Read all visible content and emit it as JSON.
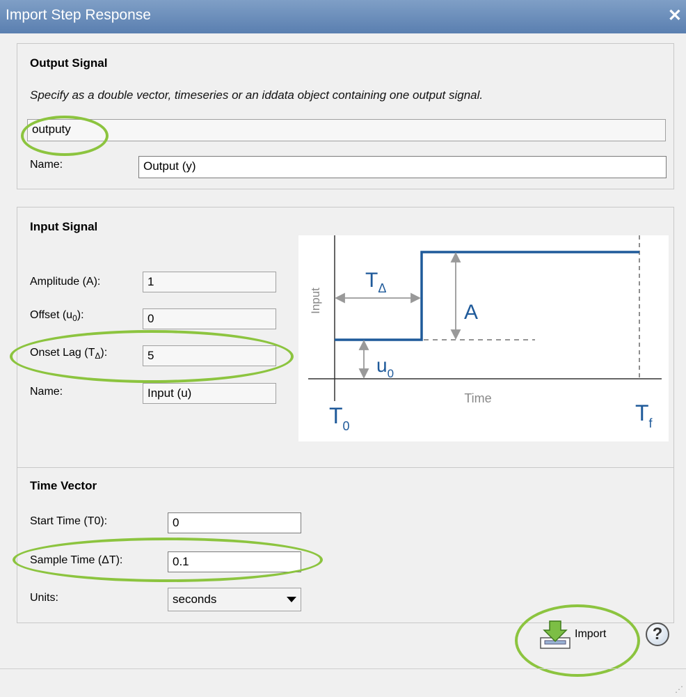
{
  "window": {
    "title": "Import Step Response",
    "close_glyph": "✕"
  },
  "output_signal": {
    "title": "Output Signal",
    "hint": "Specify as a double vector, timeseries or an iddata object containing one output signal.",
    "value": "outputy",
    "name_label": "Name:",
    "name_value": "Output (y)"
  },
  "input_signal": {
    "title": "Input Signal",
    "amplitude_label": "Amplitude (A):",
    "amplitude_value": "1",
    "offset_label": "Offset (u",
    "offset_sub": "0",
    "offset_suffix": "):",
    "offset_value": "0",
    "onset_label": "Onset Lag (T",
    "onset_sub": "Δ",
    "onset_suffix": "):",
    "onset_value": "5",
    "name_label": "Name:",
    "name_value": "Input (u)",
    "diagram": {
      "y_axis_label": "Input",
      "x_axis_label": "Time",
      "t_delta": "T",
      "t_delta_sub": "Δ",
      "amp": "A",
      "u0": "u",
      "u0_sub": "0",
      "t0": "T",
      "t0_sub": "0",
      "tf": "T",
      "tf_sub": "f",
      "accent": "#1f5a9a"
    }
  },
  "time_vector": {
    "title": "Time Vector",
    "start_label": "Start Time (T0):",
    "start_value": "0",
    "sample_label": "Sample Time (ΔT):",
    "sample_value": "0.1",
    "units_label": "Units:",
    "units_value": "seconds"
  },
  "actions": {
    "import_label": "Import",
    "help_glyph": "?"
  },
  "highlight_color": "#8cc43f"
}
